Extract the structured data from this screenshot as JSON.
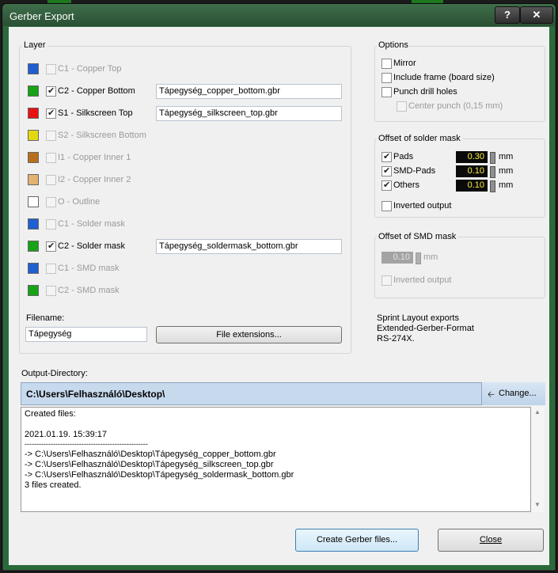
{
  "window": {
    "title": "Gerber Export",
    "help_label": "?",
    "close_label": "✕"
  },
  "layer_group": {
    "label": "Layer"
  },
  "layers": [
    {
      "color": "#1f5fd0",
      "checked": false,
      "enabled": false,
      "label": "C1 - Copper Top",
      "file": ""
    },
    {
      "color": "#16a316",
      "checked": true,
      "enabled": true,
      "label": "C2 - Copper Bottom",
      "file": "Tápegység_copper_bottom.gbr"
    },
    {
      "color": "#e81212",
      "checked": true,
      "enabled": true,
      "label": "S1 - Silkscreen Top",
      "file": "Tápegység_silkscreen_top.gbr"
    },
    {
      "color": "#e2d810",
      "checked": false,
      "enabled": false,
      "label": "S2 - Silkscreen Bottom",
      "file": ""
    },
    {
      "color": "#b86f1c",
      "checked": false,
      "enabled": false,
      "label": "I1 - Copper Inner 1",
      "file": ""
    },
    {
      "color": "#e3b170",
      "checked": false,
      "enabled": false,
      "label": "I2 - Copper Inner 2",
      "file": ""
    },
    {
      "color": "#ffffff",
      "checked": false,
      "enabled": false,
      "label": "O - Outline",
      "file": ""
    },
    {
      "color": "#1f5fd0",
      "checked": false,
      "enabled": false,
      "label": "C1 - Solder mask",
      "file": ""
    },
    {
      "color": "#16a316",
      "checked": true,
      "enabled": true,
      "label": "C2 - Solder mask",
      "file": "Tápegység_soldermask_bottom.gbr"
    },
    {
      "color": "#1f5fd0",
      "checked": false,
      "enabled": false,
      "label": "C1 - SMD mask",
      "file": ""
    },
    {
      "color": "#16a316",
      "checked": false,
      "enabled": false,
      "label": "C2 - SMD mask",
      "file": ""
    }
  ],
  "filename": {
    "label": "Filename:",
    "value": "Tápegység",
    "ext_button": "File extensions..."
  },
  "options": {
    "label": "Options",
    "mirror": "Mirror",
    "frame": "Include frame (board size)",
    "punch": "Punch drill holes",
    "center": "Center punch (0,15 mm)"
  },
  "solder_mask": {
    "label": "Offset of solder mask",
    "rows": [
      {
        "label": "Pads",
        "value": "0.30",
        "unit": "mm"
      },
      {
        "label": "SMD-Pads",
        "value": "0.10",
        "unit": "mm"
      },
      {
        "label": "Others",
        "value": "0.10",
        "unit": "mm"
      }
    ],
    "inverted": "Inverted output"
  },
  "smd_mask": {
    "label": "Offset of SMD mask",
    "value": "0.10",
    "unit": "mm",
    "inverted": "Inverted output"
  },
  "info": [
    "Sprint Layout exports",
    "Extended-Gerber-Format",
    "RS-274X."
  ],
  "output": {
    "label": "Output-Directory:",
    "path": "C:\\Users\\Felhasználó\\Desktop\\",
    "change_button": "Change...",
    "change_icon": "left-arrow-icon",
    "log": [
      "Created files:",
      "",
      "2021.01.19.  15:39:17",
      "----------------------------------------------------",
      "-> C:\\Users\\Felhasználó\\Desktop\\Tápegység_copper_bottom.gbr",
      "-> C:\\Users\\Felhasználó\\Desktop\\Tápegység_silkscreen_top.gbr",
      "-> C:\\Users\\Felhasználó\\Desktop\\Tápegység_soldermask_bottom.gbr",
      "3 files created."
    ]
  },
  "buttons": {
    "create": "Create Gerber files...",
    "close": "Close"
  }
}
